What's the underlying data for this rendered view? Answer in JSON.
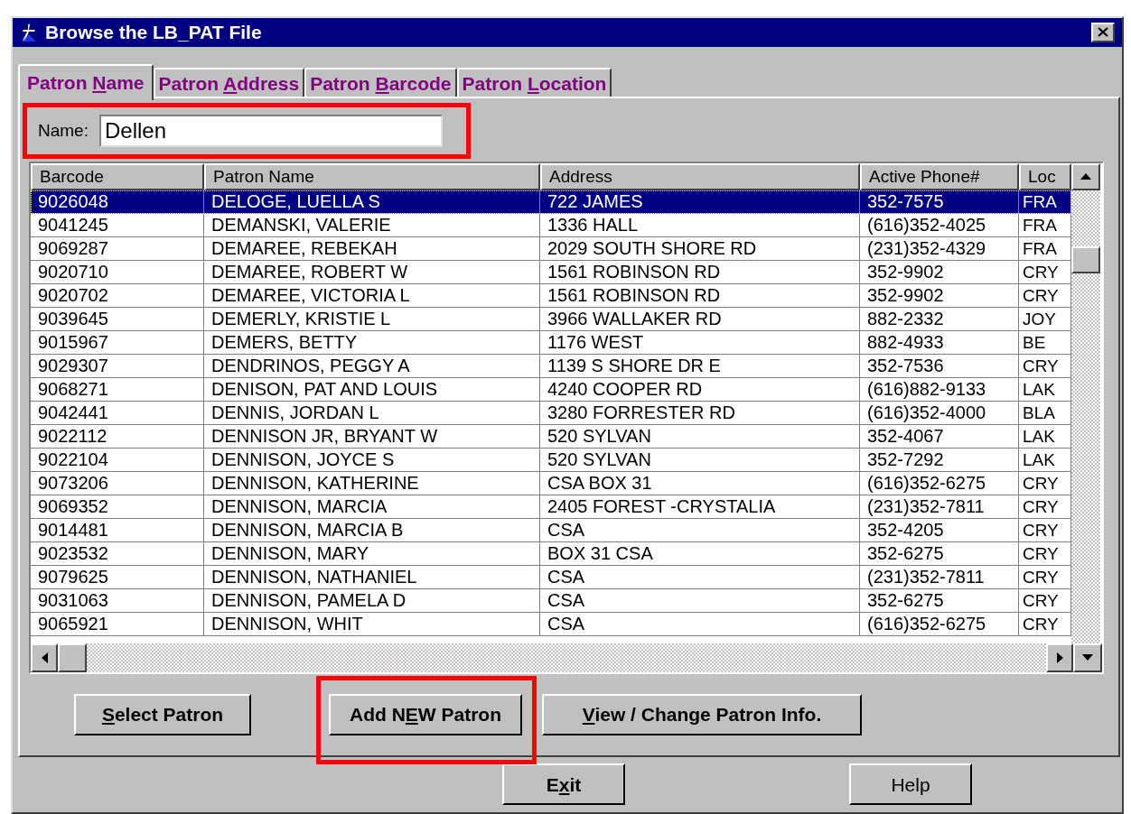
{
  "window": {
    "title": "Browse the LB_PAT File"
  },
  "tabs": [
    {
      "label": {
        "pre": "Patron ",
        "key": "N",
        "post": "ame"
      },
      "selected": true
    },
    {
      "label": {
        "pre": "Patron ",
        "key": "A",
        "post": "ddress"
      },
      "selected": false
    },
    {
      "label": {
        "pre": "Patron ",
        "key": "B",
        "post": "arcode"
      },
      "selected": false
    },
    {
      "label": {
        "pre": "Patron ",
        "key": "L",
        "post": "ocation"
      },
      "selected": false
    }
  ],
  "name_field": {
    "label": "Name:",
    "value": "Dellen",
    "highlighted": true
  },
  "table": {
    "columns": [
      "Barcode",
      "Patron Name",
      "Address",
      "Active Phone#",
      "Loc"
    ],
    "rows": [
      {
        "cells": [
          "9026048",
          "DELOGE, LUELLA  S",
          "722 JAMES",
          "352-7575",
          "FRA"
        ],
        "selected": true
      },
      {
        "cells": [
          "9041245",
          "DEMANSKI, VALERIE",
          "1336 HALL",
          "(616)352-4025",
          "FRA"
        ],
        "selected": false
      },
      {
        "cells": [
          "9069287",
          "DEMAREE, REBEKAH",
          "2029 SOUTH SHORE RD",
          "(231)352-4329",
          "FRA"
        ],
        "selected": false
      },
      {
        "cells": [
          "9020710",
          "DEMAREE, ROBERT  W",
          "1561 ROBINSON RD",
          "352-9902",
          "CRY"
        ],
        "selected": false
      },
      {
        "cells": [
          "9020702",
          "DEMAREE, VICTORIA  L",
          "1561 ROBINSON RD",
          "352-9902",
          "CRY"
        ],
        "selected": false
      },
      {
        "cells": [
          "9039645",
          "DEMERLY, KRISTIE  L",
          "3966 WALLAKER RD",
          "882-2332",
          "JOY"
        ],
        "selected": false
      },
      {
        "cells": [
          "9015967",
          "DEMERS, BETTY",
          "1176 WEST",
          "882-4933",
          "BE"
        ],
        "selected": false
      },
      {
        "cells": [
          "9029307",
          "DENDRINOS, PEGGY  A",
          "1139 S SHORE DR E",
          "352-7536",
          "CRY"
        ],
        "selected": false
      },
      {
        "cells": [
          "9068271",
          "DENISON, PAT AND LOUIS",
          "4240 COOPER RD",
          "(616)882-9133",
          "LAK"
        ],
        "selected": false
      },
      {
        "cells": [
          "9042441",
          "DENNIS, JORDAN  L",
          "3280 FORRESTER RD",
          "(616)352-4000",
          "BLA"
        ],
        "selected": false
      },
      {
        "cells": [
          "9022112",
          "DENNISON JR, BRYANT  W",
          "520 SYLVAN",
          "352-4067",
          "LAK"
        ],
        "selected": false
      },
      {
        "cells": [
          "9022104",
          "DENNISON, JOYCE  S",
          "520 SYLVAN",
          "352-7292",
          "LAK"
        ],
        "selected": false
      },
      {
        "cells": [
          "9073206",
          "DENNISON, KATHERINE",
          "CSA BOX 31",
          "(616)352-6275",
          "CRY"
        ],
        "selected": false
      },
      {
        "cells": [
          "9069352",
          "DENNISON, MARCIA",
          "2405 FOREST -CRYSTALIA",
          "(231)352-7811",
          "CRY"
        ],
        "selected": false
      },
      {
        "cells": [
          "9014481",
          "DENNISON, MARCIA  B",
          "CSA",
          "352-4205",
          "CRY"
        ],
        "selected": false
      },
      {
        "cells": [
          "9023532",
          "DENNISON, MARY",
          "BOX 31 CSA",
          "352-6275",
          "CRY"
        ],
        "selected": false
      },
      {
        "cells": [
          "9079625",
          "DENNISON, NATHANIEL",
          "CSA",
          "(231)352-7811",
          "CRY"
        ],
        "selected": false
      },
      {
        "cells": [
          "9031063",
          "DENNISON, PAMELA  D",
          "CSA",
          "352-6275",
          "CRY"
        ],
        "selected": false
      },
      {
        "cells": [
          "9065921",
          "DENNISON, WHIT",
          "CSA",
          "(616)352-6275",
          "CRY"
        ],
        "selected": false
      }
    ]
  },
  "action_buttons": [
    {
      "label": {
        "key": "S",
        "post": "elect Patron"
      },
      "highlighted": false
    },
    {
      "label": {
        "pre": "Add N",
        "key": "E",
        "post": "W Patron"
      },
      "highlighted": true
    },
    {
      "label": {
        "key": "V",
        "post": "iew / Change Patron Info."
      },
      "highlighted": false
    }
  ],
  "footer_buttons": [
    {
      "label": {
        "pre": "E",
        "key": "x",
        "post": "it"
      },
      "bold": true
    },
    {
      "label": {
        "pre": "Help"
      },
      "bold": false
    }
  ]
}
